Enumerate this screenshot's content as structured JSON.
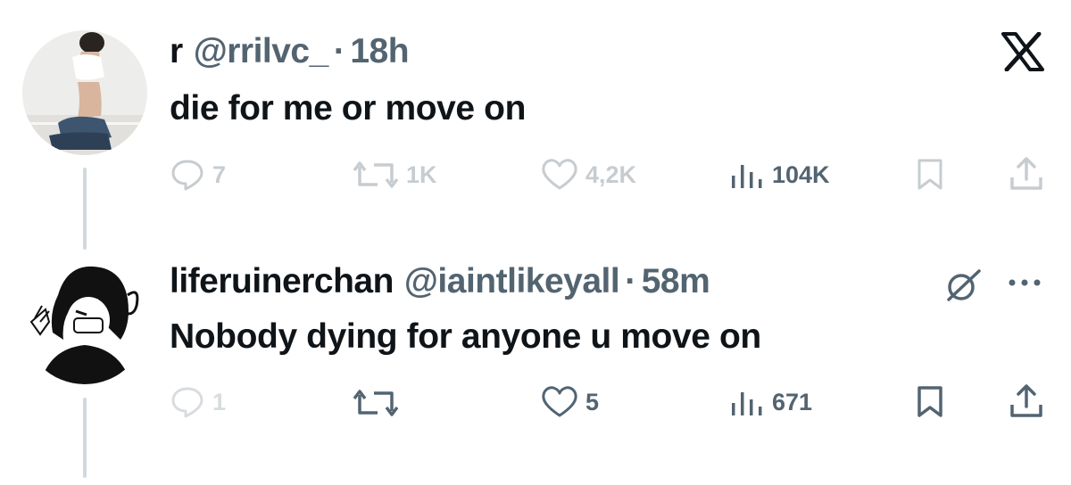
{
  "brand_logo": "X",
  "colors": {
    "text": "#0f1419",
    "secondary": "#536471",
    "thread_line": "#cfd9de"
  },
  "tweet1": {
    "name": "r",
    "handle": "@rrilvc_",
    "separator": "·",
    "time": "18h",
    "text": "die for me or move on",
    "actions": {
      "replies": "7",
      "reposts": "1K",
      "likes": "4,2K",
      "views": "104K"
    }
  },
  "tweet2": {
    "name": "liferuinerchan",
    "handle": "@iaintlikeyall",
    "separator": "·",
    "time": "58m",
    "text": "Nobody dying for anyone u move on",
    "actions": {
      "replies": "1",
      "likes": "5",
      "views": "671"
    }
  },
  "icons": [
    "x-logo-icon",
    "reply-icon",
    "repost-icon",
    "like-icon",
    "views-icon",
    "bookmark-icon",
    "share-icon",
    "grok-icon",
    "more-icon"
  ]
}
